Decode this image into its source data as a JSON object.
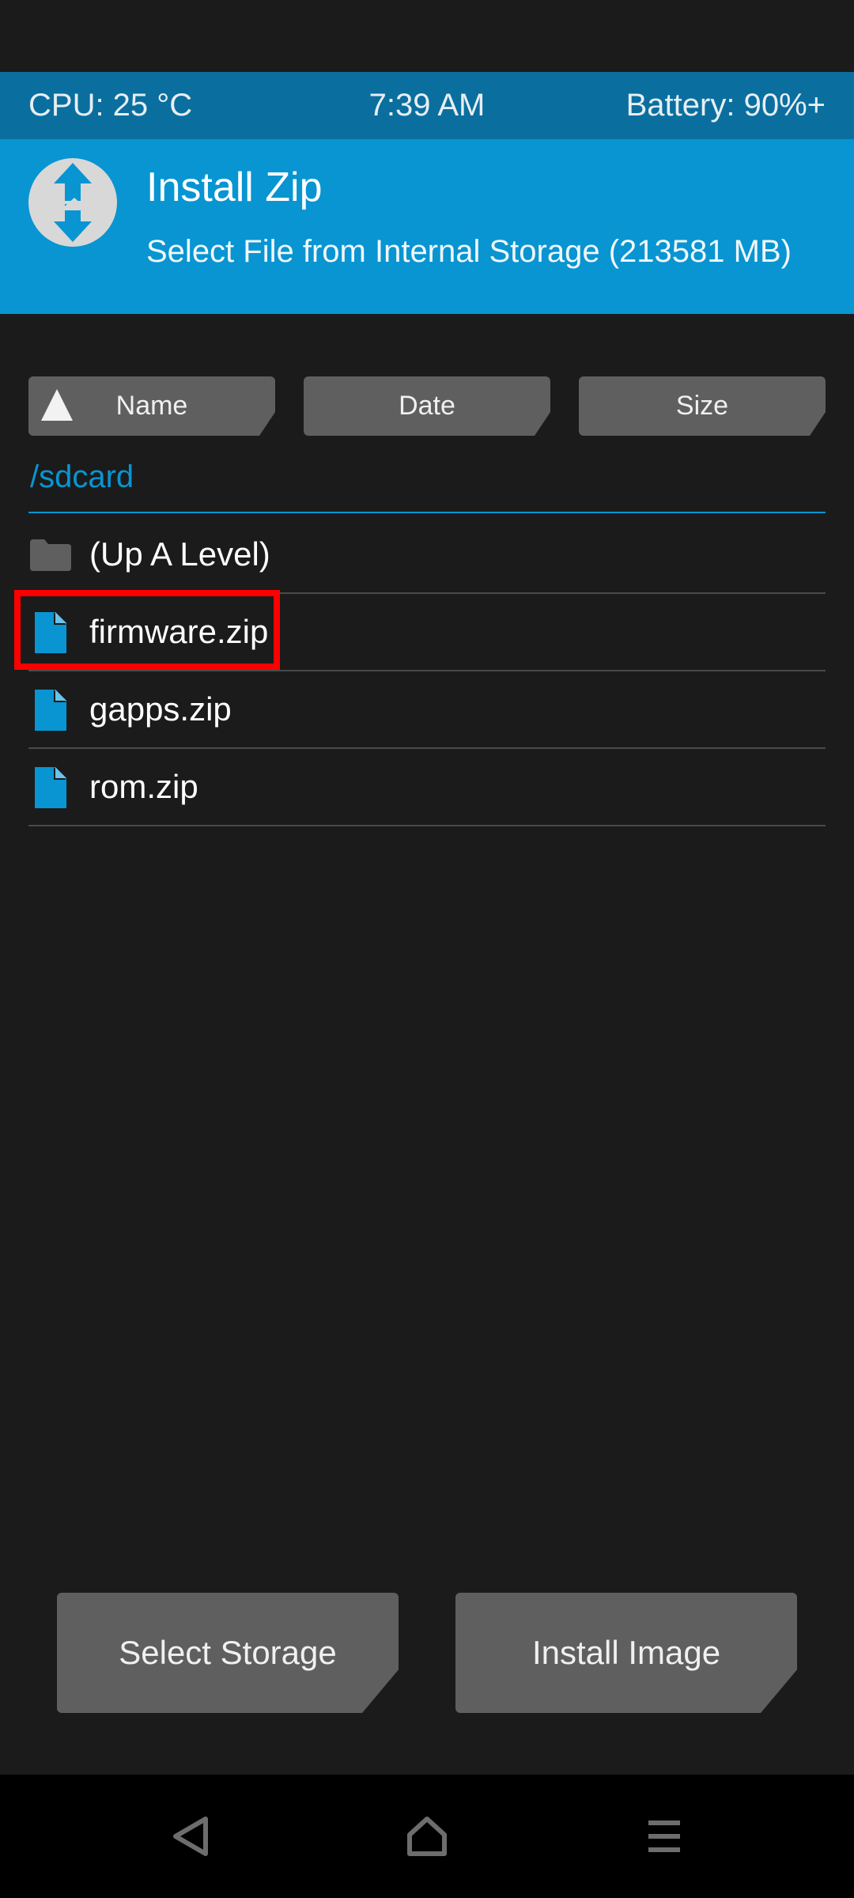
{
  "status_bar": {
    "cpu": "CPU: 25 °C",
    "time": "7:39 AM",
    "battery": "Battery: 90%+"
  },
  "header": {
    "logo_icon": "twrp-logo-icon",
    "title": "Install Zip",
    "subtitle": "Select File from Internal Storage (213581 MB)"
  },
  "sort_buttons": [
    {
      "label": "Name",
      "icon": "sort-ascending-arrow-icon",
      "active": true
    },
    {
      "label": "Date"
    },
    {
      "label": "Size"
    }
  ],
  "path": "/sdcard",
  "files": [
    {
      "name": "(Up A Level)",
      "icon": "folder-icon"
    },
    {
      "name": "firmware.zip",
      "icon": "file-icon",
      "highlighted": true
    },
    {
      "name": "gapps.zip",
      "icon": "file-icon"
    },
    {
      "name": "rom.zip",
      "icon": "file-icon"
    }
  ],
  "actions": {
    "select_storage": "Select Storage",
    "install_image": "Install Image"
  },
  "nav": [
    "back-icon",
    "home-icon",
    "menu-icon"
  ],
  "colors": {
    "background": "#1b1b1b",
    "status_bar": "#0a6f9f",
    "header": "#0895d2",
    "accent": "#0895d2",
    "button": "#5f5f5f",
    "highlight": "#ff0000"
  }
}
